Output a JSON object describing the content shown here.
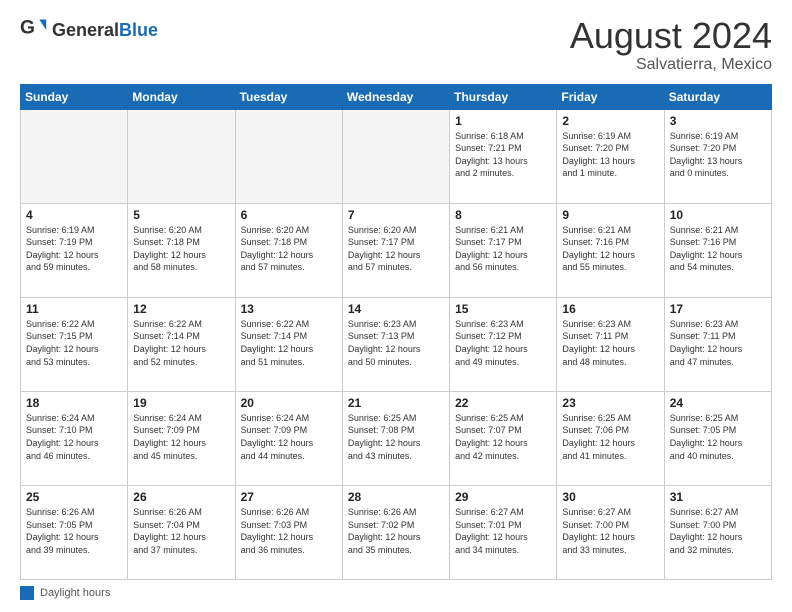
{
  "header": {
    "logo_general": "General",
    "logo_blue": "Blue",
    "month_year": "August 2024",
    "location": "Salvatierra, Mexico"
  },
  "days_of_week": [
    "Sunday",
    "Monday",
    "Tuesday",
    "Wednesday",
    "Thursday",
    "Friday",
    "Saturday"
  ],
  "legend_label": "Daylight hours",
  "weeks": [
    [
      {
        "day": "",
        "info": ""
      },
      {
        "day": "",
        "info": ""
      },
      {
        "day": "",
        "info": ""
      },
      {
        "day": "",
        "info": ""
      },
      {
        "day": "1",
        "info": "Sunrise: 6:18 AM\nSunset: 7:21 PM\nDaylight: 13 hours\nand 2 minutes."
      },
      {
        "day": "2",
        "info": "Sunrise: 6:19 AM\nSunset: 7:20 PM\nDaylight: 13 hours\nand 1 minute."
      },
      {
        "day": "3",
        "info": "Sunrise: 6:19 AM\nSunset: 7:20 PM\nDaylight: 13 hours\nand 0 minutes."
      }
    ],
    [
      {
        "day": "4",
        "info": "Sunrise: 6:19 AM\nSunset: 7:19 PM\nDaylight: 12 hours\nand 59 minutes."
      },
      {
        "day": "5",
        "info": "Sunrise: 6:20 AM\nSunset: 7:18 PM\nDaylight: 12 hours\nand 58 minutes."
      },
      {
        "day": "6",
        "info": "Sunrise: 6:20 AM\nSunset: 7:18 PM\nDaylight: 12 hours\nand 57 minutes."
      },
      {
        "day": "7",
        "info": "Sunrise: 6:20 AM\nSunset: 7:17 PM\nDaylight: 12 hours\nand 57 minutes."
      },
      {
        "day": "8",
        "info": "Sunrise: 6:21 AM\nSunset: 7:17 PM\nDaylight: 12 hours\nand 56 minutes."
      },
      {
        "day": "9",
        "info": "Sunrise: 6:21 AM\nSunset: 7:16 PM\nDaylight: 12 hours\nand 55 minutes."
      },
      {
        "day": "10",
        "info": "Sunrise: 6:21 AM\nSunset: 7:16 PM\nDaylight: 12 hours\nand 54 minutes."
      }
    ],
    [
      {
        "day": "11",
        "info": "Sunrise: 6:22 AM\nSunset: 7:15 PM\nDaylight: 12 hours\nand 53 minutes."
      },
      {
        "day": "12",
        "info": "Sunrise: 6:22 AM\nSunset: 7:14 PM\nDaylight: 12 hours\nand 52 minutes."
      },
      {
        "day": "13",
        "info": "Sunrise: 6:22 AM\nSunset: 7:14 PM\nDaylight: 12 hours\nand 51 minutes."
      },
      {
        "day": "14",
        "info": "Sunrise: 6:23 AM\nSunset: 7:13 PM\nDaylight: 12 hours\nand 50 minutes."
      },
      {
        "day": "15",
        "info": "Sunrise: 6:23 AM\nSunset: 7:12 PM\nDaylight: 12 hours\nand 49 minutes."
      },
      {
        "day": "16",
        "info": "Sunrise: 6:23 AM\nSunset: 7:11 PM\nDaylight: 12 hours\nand 48 minutes."
      },
      {
        "day": "17",
        "info": "Sunrise: 6:23 AM\nSunset: 7:11 PM\nDaylight: 12 hours\nand 47 minutes."
      }
    ],
    [
      {
        "day": "18",
        "info": "Sunrise: 6:24 AM\nSunset: 7:10 PM\nDaylight: 12 hours\nand 46 minutes."
      },
      {
        "day": "19",
        "info": "Sunrise: 6:24 AM\nSunset: 7:09 PM\nDaylight: 12 hours\nand 45 minutes."
      },
      {
        "day": "20",
        "info": "Sunrise: 6:24 AM\nSunset: 7:09 PM\nDaylight: 12 hours\nand 44 minutes."
      },
      {
        "day": "21",
        "info": "Sunrise: 6:25 AM\nSunset: 7:08 PM\nDaylight: 12 hours\nand 43 minutes."
      },
      {
        "day": "22",
        "info": "Sunrise: 6:25 AM\nSunset: 7:07 PM\nDaylight: 12 hours\nand 42 minutes."
      },
      {
        "day": "23",
        "info": "Sunrise: 6:25 AM\nSunset: 7:06 PM\nDaylight: 12 hours\nand 41 minutes."
      },
      {
        "day": "24",
        "info": "Sunrise: 6:25 AM\nSunset: 7:05 PM\nDaylight: 12 hours\nand 40 minutes."
      }
    ],
    [
      {
        "day": "25",
        "info": "Sunrise: 6:26 AM\nSunset: 7:05 PM\nDaylight: 12 hours\nand 39 minutes."
      },
      {
        "day": "26",
        "info": "Sunrise: 6:26 AM\nSunset: 7:04 PM\nDaylight: 12 hours\nand 37 minutes."
      },
      {
        "day": "27",
        "info": "Sunrise: 6:26 AM\nSunset: 7:03 PM\nDaylight: 12 hours\nand 36 minutes."
      },
      {
        "day": "28",
        "info": "Sunrise: 6:26 AM\nSunset: 7:02 PM\nDaylight: 12 hours\nand 35 minutes."
      },
      {
        "day": "29",
        "info": "Sunrise: 6:27 AM\nSunset: 7:01 PM\nDaylight: 12 hours\nand 34 minutes."
      },
      {
        "day": "30",
        "info": "Sunrise: 6:27 AM\nSunset: 7:00 PM\nDaylight: 12 hours\nand 33 minutes."
      },
      {
        "day": "31",
        "info": "Sunrise: 6:27 AM\nSunset: 7:00 PM\nDaylight: 12 hours\nand 32 minutes."
      }
    ]
  ]
}
